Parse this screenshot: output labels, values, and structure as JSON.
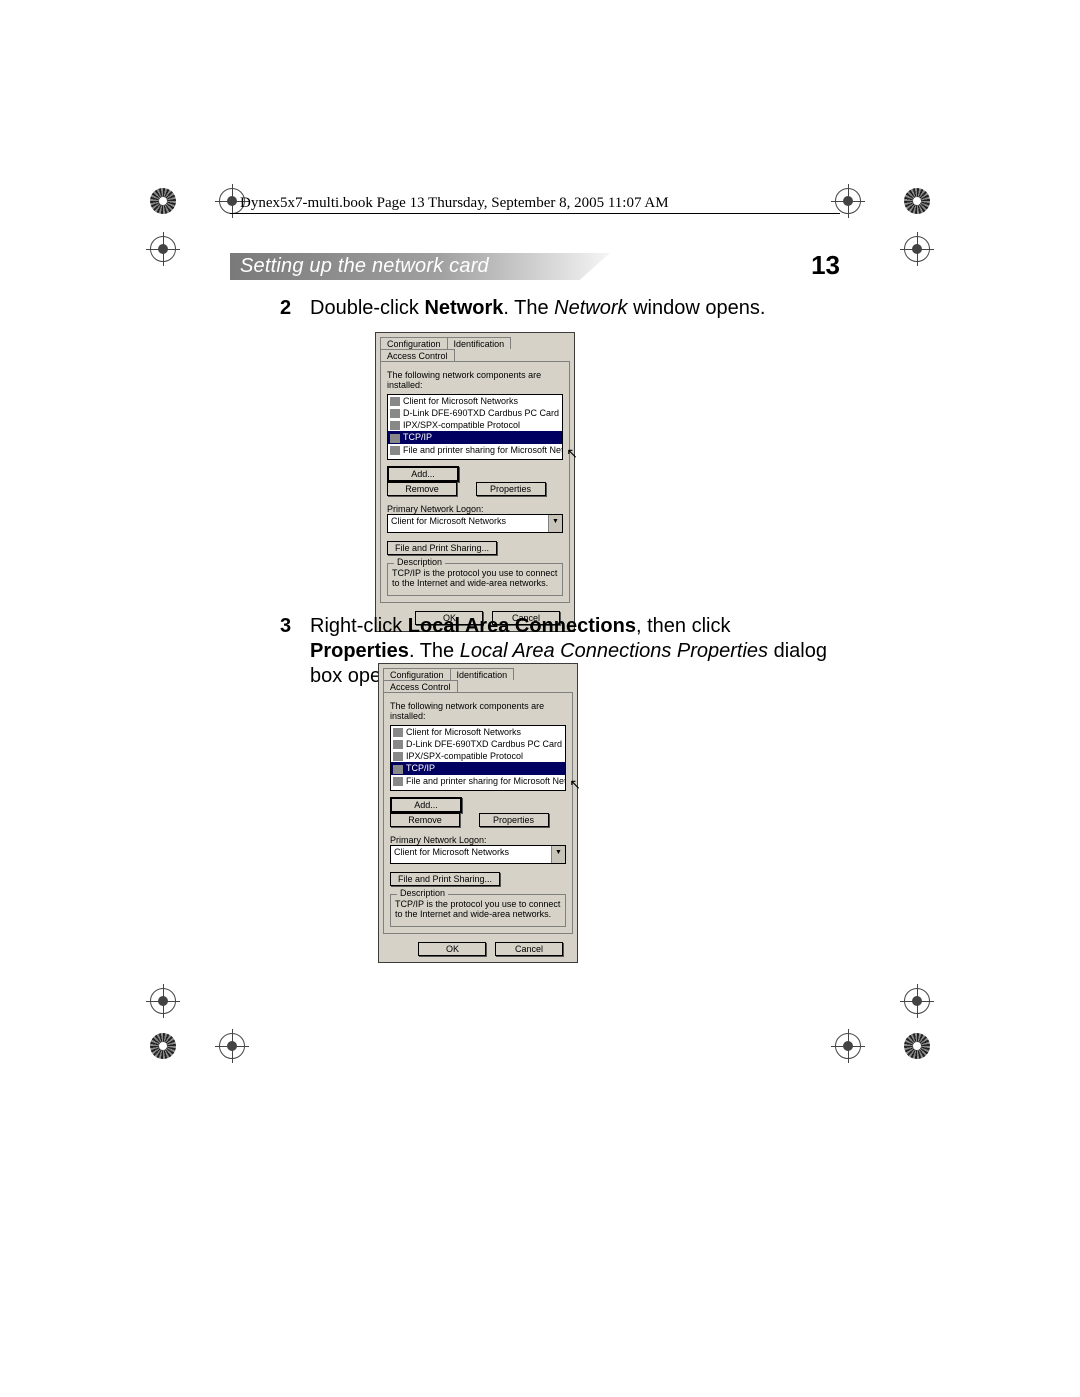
{
  "header_line": "Dynex5x7-multi.book  Page 13  Thursday, September 8, 2005  11:07 AM",
  "section": {
    "title": "Setting up the network card",
    "page_number": "13"
  },
  "steps": {
    "s2": {
      "num": "2",
      "plain_1": "Double-click ",
      "bold_1": "Network",
      "plain_2": ". The ",
      "italic_1": "Network",
      "plain_3": " window opens."
    },
    "s3": {
      "num": "3",
      "plain_1": "Right-click ",
      "bold_1": "Local Area Connections",
      "plain_2": ", then click ",
      "bold_2": "Properties",
      "plain_3": ". The ",
      "italic_1": "Local Area Connections Properties",
      "plain_4": " dialog box opens."
    }
  },
  "dialog": {
    "tabs": {
      "t1": "Configuration",
      "t2": "Identification",
      "t3": "Access Control"
    },
    "components_label": "The following network components are installed:",
    "list": {
      "i1": "Client for Microsoft Networks",
      "i2": "D-Link DFE-690TXD Cardbus PC Card",
      "i3": "IPX/SPX-compatible Protocol",
      "i4": "TCP/IP",
      "i5": "File and printer sharing for Microsoft Networks"
    },
    "btn_add": "Add...",
    "btn_remove": "Remove",
    "btn_properties": "Properties",
    "logon_label": "Primary Network Logon:",
    "logon_value": "Client for Microsoft Networks",
    "btn_fileprint": "File and Print Sharing...",
    "desc_title": "Description",
    "desc_text": "TCP/IP is the protocol you use to connect to the Internet and wide-area networks.",
    "ok": "OK",
    "cancel": "Cancel"
  }
}
